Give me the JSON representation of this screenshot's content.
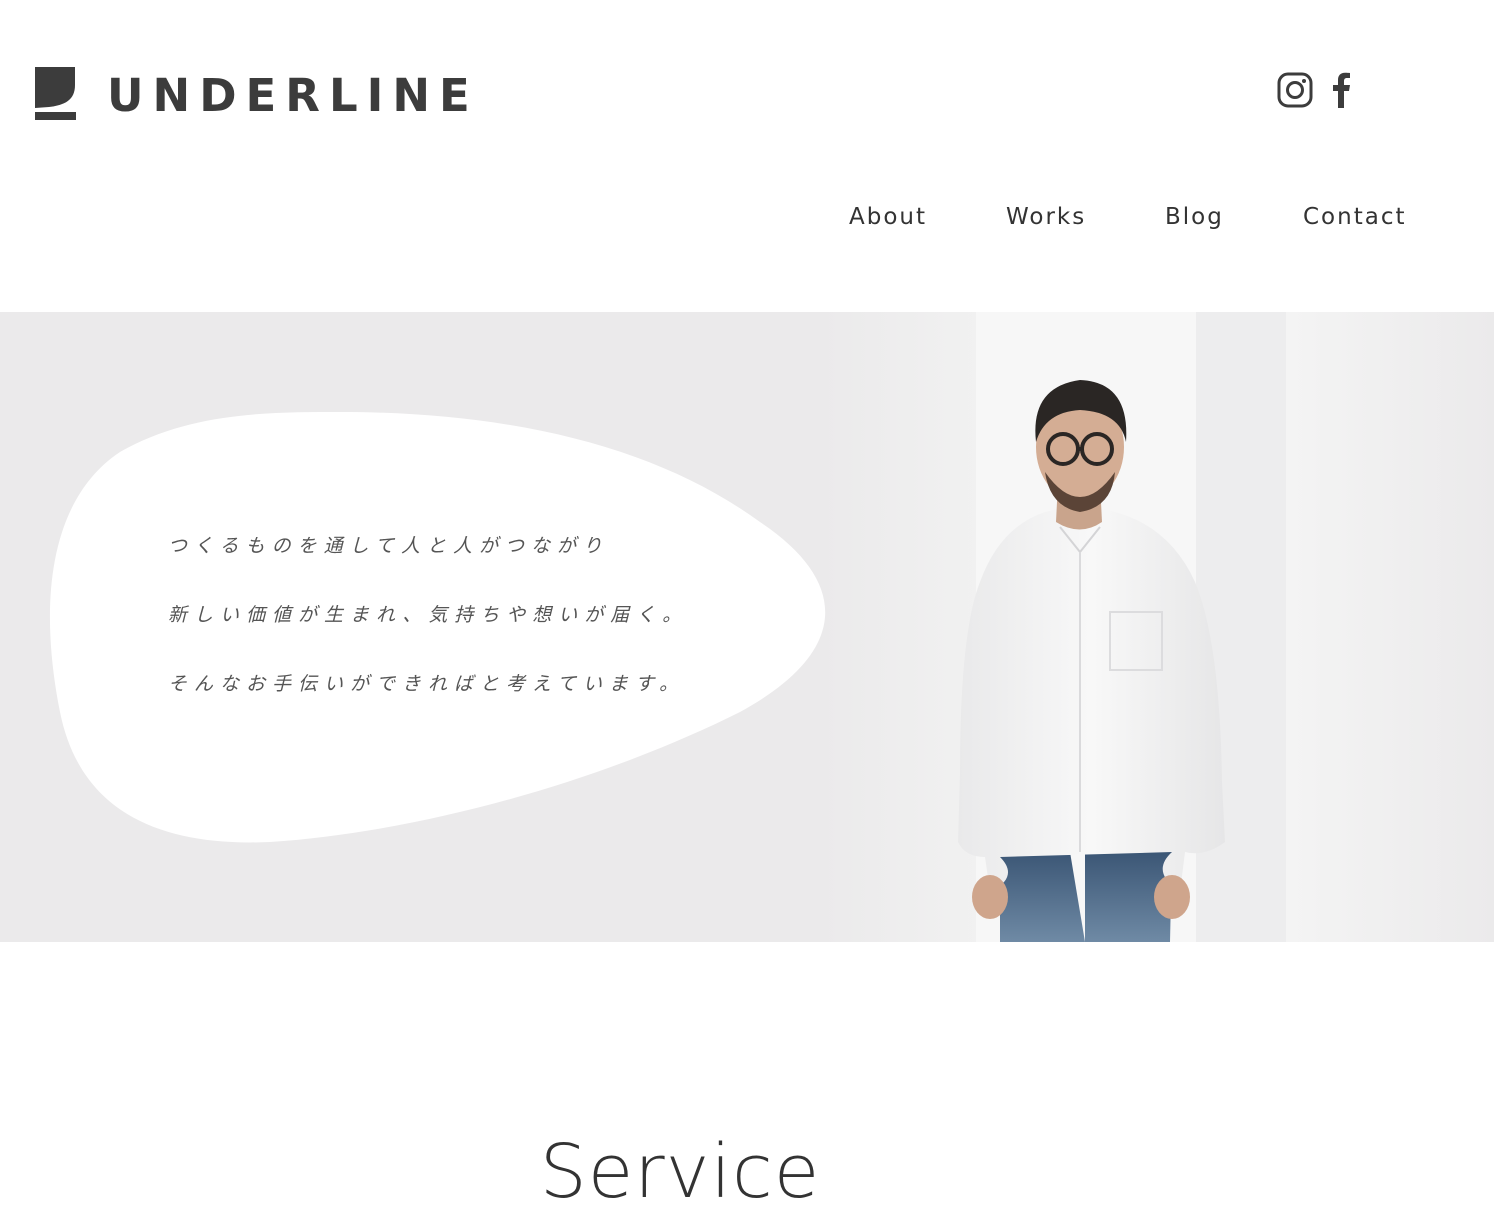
{
  "brand": {
    "name": "UNDERLINE"
  },
  "social": [
    {
      "icon": "instagram-icon",
      "label": "Instagram"
    },
    {
      "icon": "facebook-icon",
      "label": "Facebook"
    }
  ],
  "nav": {
    "items": [
      {
        "label": "About"
      },
      {
        "label": "Works"
      },
      {
        "label": "Blog"
      },
      {
        "label": "Contact"
      }
    ]
  },
  "hero": {
    "lines": [
      "つくるものを通して人と人がつながり",
      "新しい価値が生まれ、気持ちや想いが届く。",
      "そんなお手伝いができればと考えています。"
    ]
  },
  "service": {
    "title": "Service"
  },
  "colors": {
    "text": "#333333",
    "logo": "#3c3c3c",
    "hero_bg": "#ebeaeb",
    "bubble": "#ffffff"
  }
}
